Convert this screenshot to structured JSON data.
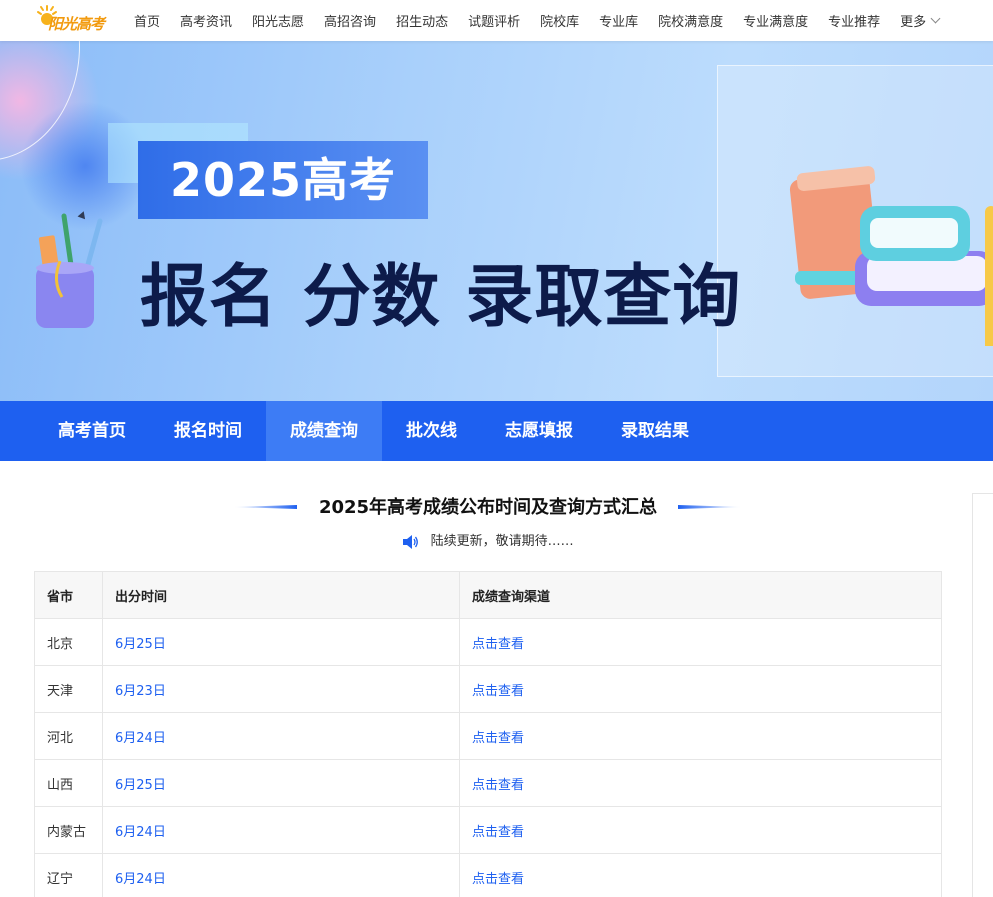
{
  "logo": {
    "text": "阳光高考"
  },
  "topnav": {
    "items": [
      "首页",
      "高考资讯",
      "阳光志愿",
      "高招咨询",
      "招生动态",
      "试题评析",
      "院校库",
      "专业库",
      "院校满意度",
      "专业满意度",
      "专业推荐"
    ],
    "more_label": "更多"
  },
  "banner": {
    "year_title": "2025高考",
    "slogan": "报名 分数 录取查询"
  },
  "tabs": {
    "items": [
      "高考首页",
      "报名时间",
      "成绩查询",
      "批次线",
      "志愿填报",
      "录取结果"
    ],
    "active_index": 2
  },
  "section": {
    "title": "2025年高考成绩公布时间及查询方式汇总",
    "notice": "陆续更新，敬请期待……"
  },
  "table": {
    "headers": [
      "省市",
      "出分时间",
      "成绩查询渠道"
    ],
    "rows": [
      {
        "province": "北京",
        "date": "6月25日",
        "link": "点击查看"
      },
      {
        "province": "天津",
        "date": "6月23日",
        "link": "点击查看"
      },
      {
        "province": "河北",
        "date": "6月24日",
        "link": "点击查看"
      },
      {
        "province": "山西",
        "date": "6月25日",
        "link": "点击查看"
      },
      {
        "province": "内蒙古",
        "date": "6月24日",
        "link": "点击查看"
      },
      {
        "province": "辽宁",
        "date": "6月24日",
        "link": "点击查看"
      }
    ]
  },
  "colors": {
    "primary": "#1e60f0",
    "tab_active": "#3d7cf5",
    "slogan": "#0d1b4a",
    "logo": "#f29a0e"
  }
}
